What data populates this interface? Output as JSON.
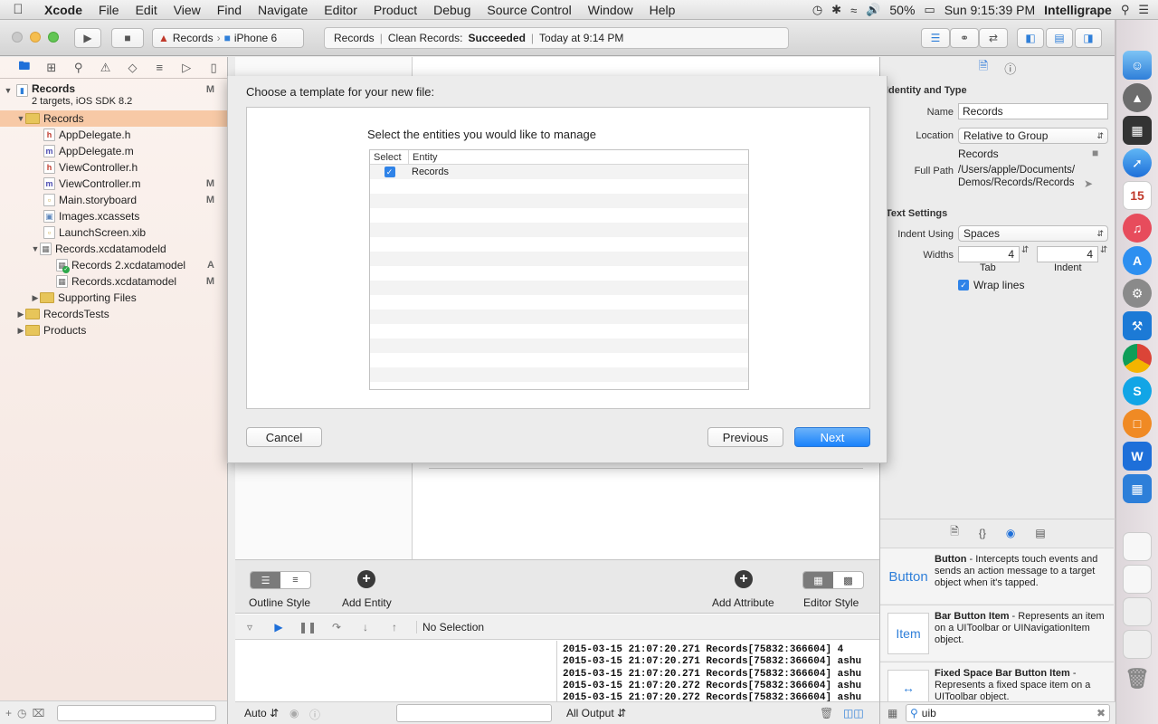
{
  "menubar": {
    "apple": "",
    "app": "Xcode",
    "items": [
      "File",
      "Edit",
      "View",
      "Find",
      "Navigate",
      "Editor",
      "Product",
      "Debug",
      "Source Control",
      "Window",
      "Help"
    ],
    "battery": "50%",
    "clock": "Sun 9:15:39 PM",
    "user": "Intelligrape"
  },
  "toolbar": {
    "scheme": "Records",
    "device": "iPhone 6",
    "activity": {
      "project": "Records",
      "action": "Clean Records:",
      "status": "Succeeded",
      "time": "Today at 9:14 PM"
    }
  },
  "navigator": {
    "project": {
      "name": "Records",
      "subtitle": "2 targets, iOS SDK 8.2",
      "badge": "M"
    },
    "rows": [
      {
        "label": "Records",
        "badge": ""
      },
      {
        "label": "AppDelegate.h",
        "badge": ""
      },
      {
        "label": "AppDelegate.m",
        "badge": ""
      },
      {
        "label": "ViewController.h",
        "badge": ""
      },
      {
        "label": "ViewController.m",
        "badge": "M"
      },
      {
        "label": "Main.storyboard",
        "badge": "M"
      },
      {
        "label": "Images.xcassets",
        "badge": ""
      },
      {
        "label": "LaunchScreen.xib",
        "badge": ""
      },
      {
        "label": "Records.xcdatamodeld",
        "badge": ""
      },
      {
        "label": "Records 2.xcdatamodel",
        "badge": "A"
      },
      {
        "label": "Records.xcdatamodel",
        "badge": "M"
      },
      {
        "label": "Supporting Files",
        "badge": ""
      },
      {
        "label": "RecordsTests",
        "badge": ""
      },
      {
        "label": "Products",
        "badge": ""
      }
    ]
  },
  "dialog": {
    "title": "Choose a template for your new file:",
    "prompt": "Select the entities you would like to manage",
    "columns": [
      "Select",
      "Entity"
    ],
    "entities": [
      {
        "name": "Records",
        "checked": true
      }
    ],
    "buttons": {
      "cancel": "Cancel",
      "previous": "Previous",
      "next": "Next"
    }
  },
  "editor_bar": {
    "outline_style": "Outline Style",
    "add_entity": "Add Entity",
    "add_attribute": "Add Attribute",
    "editor_style": "Editor Style"
  },
  "debug": {
    "selection": "No Selection",
    "console_lines": [
      "2015-03-15 21:07:20.271 Records[75832:366604] 4",
      "2015-03-15 21:07:20.271 Records[75832:366604] ashu",
      "2015-03-15 21:07:20.271 Records[75832:366604] ashu",
      "2015-03-15 21:07:20.272 Records[75832:366604] ashu",
      "2015-03-15 21:07:20.272 Records[75832:366604] ashu"
    ],
    "auto_label": "Auto",
    "output_label": "All Output"
  },
  "inspector": {
    "identity_title": "Identity and Type",
    "name_label": "Name",
    "name_value": "Records",
    "location_label": "Location",
    "location_value": "Relative to Group",
    "location_path": "Records",
    "fullpath_label": "Full Path",
    "fullpath_line1": "/Users/apple/Documents/",
    "fullpath_line2": "Demos/Records/Records",
    "text_title": "Text Settings",
    "indent_label": "Indent Using",
    "indent_value": "Spaces",
    "widths_label": "Widths",
    "tab_value": "4",
    "indent_width_value": "4",
    "tab_label": "Tab",
    "indent_label2": "Indent",
    "wrap_label": "Wrap lines",
    "library": [
      {
        "thumb": "Button",
        "name": "Button",
        "desc": " - Intercepts touch events and sends an action message to a target object when it's tapped."
      },
      {
        "thumb": "Item",
        "name": "Bar Button Item",
        "desc": " - Represents an item on a UIToolbar or UINavigationItem object."
      },
      {
        "thumb": "",
        "name": "Fixed Space Bar Button Item",
        "desc": " - Represents a fixed space item on a UIToolbar object."
      }
    ],
    "search_value": "uib"
  },
  "colors": {
    "accent": "#1a82fb",
    "selection": "#f7c9a6",
    "folder": "#e7c55a"
  }
}
